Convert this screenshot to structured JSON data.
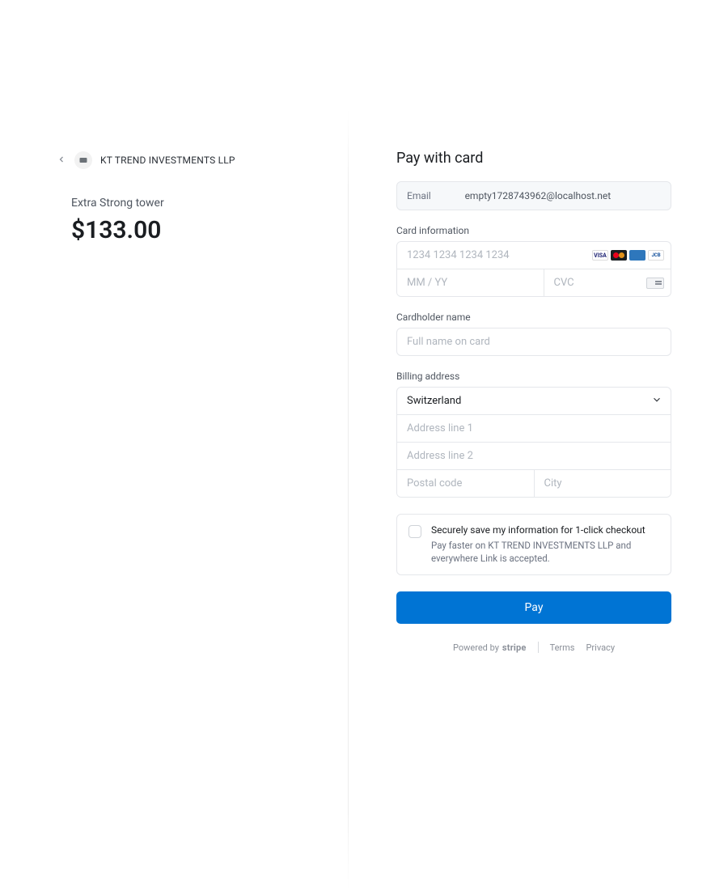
{
  "merchant": {
    "name": "KT TREND INVESTMENTS LLP"
  },
  "product": {
    "name": "Extra Strong tower",
    "price": "$133.00"
  },
  "form": {
    "title": "Pay with card",
    "email_label": "Email",
    "email_value": "empty1728743962@localhost.net",
    "card_label": "Card information",
    "card_number_placeholder": "1234 1234 1234 1234",
    "expiry_placeholder": "MM / YY",
    "cvc_placeholder": "CVC",
    "cardholder_label": "Cardholder name",
    "cardholder_placeholder": "Full name on card",
    "billing_label": "Billing address",
    "country": "Switzerland",
    "address1_placeholder": "Address line 1",
    "address2_placeholder": "Address line 2",
    "postal_placeholder": "Postal code",
    "city_placeholder": "City",
    "save_title": "Securely save my information for 1-click checkout",
    "save_sub": "Pay faster on KT TREND INVESTMENTS LLP and everywhere Link is accepted.",
    "pay_button": "Pay"
  },
  "footer": {
    "powered": "Powered by",
    "brand": "stripe",
    "terms": "Terms",
    "privacy": "Privacy"
  }
}
